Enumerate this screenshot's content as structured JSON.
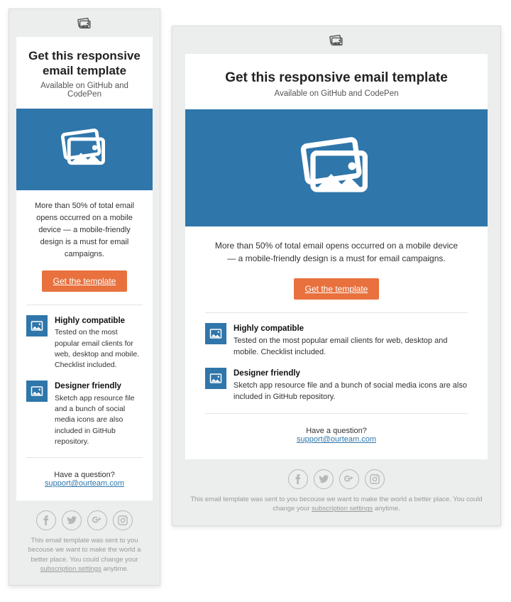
{
  "title": "Get this responsive email template",
  "subtitle": "Available on GitHub and CodePen",
  "lead_narrow": "More than 50% of total email opens occurred on a mobile device — a mobile-friendly design is a must for email campaigns.",
  "lead_wide": "More than 50% of total email opens occurred on a mobile device — a mobile-friendly design is a must for email campaigns.",
  "cta": "Get the template",
  "features": [
    {
      "title": "Highly compatible",
      "body_narrow": "Tested on the most popular email clients for web, desktop and mobile. Checklist included.",
      "body_wide": "Tested on the most popular email clients for web, desktop and mobile. Checklist included."
    },
    {
      "title": "Designer friendly",
      "body_narrow": "Sketch app resource file and a bunch of social media icons are also included in GitHub repository.",
      "body_wide": "Sketch app resource file and a bunch of social media icons are also included in GitHub repository."
    }
  ],
  "question": "Have a question?",
  "support_email": "support@ourteam.com",
  "footer_pre": "This email template was sent to you becouse we want to make the world a better place. You could change your ",
  "footer_link": "subscription settings",
  "footer_post": " anytime.",
  "colors": {
    "brand": "#2f76aa",
    "cta": "#e8713e"
  }
}
